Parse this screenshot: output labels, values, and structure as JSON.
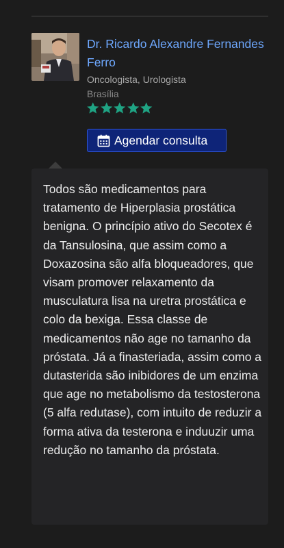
{
  "doctor": {
    "name": "Dr. Ricardo Alexandre Fernandes Ferro",
    "specialty": "Oncologista, Urologista",
    "city": "Brasília",
    "rating_stars": 5,
    "rating_max": 5
  },
  "actions": {
    "book_label": "Agendar consulta"
  },
  "answer": {
    "text": "Todos são medicamentos para tratamento de Hiperplasia prostática benigna. O princípio ativo do Secotex é da Tansulosina, que assim como a Doxazosina são alfa bloqueadores, que visam promover relaxamento da musculatura lisa na uretra prostática e colo da bexiga. Essa classe de medicamentos não age no tamanho da próstata. Já a finasteriada, assim como a dutasterida são inibidores de um enzima que age no metabolismo da testosterona (5 alfa redutase), com intuito de reduzir a forma ativa da testerona e induuzir uma redução no tamanho da próstata."
  },
  "colors": {
    "background": "#1c1c1c",
    "name_link": "#6ea8fe",
    "star": "#1fa383",
    "button_bg": "#0e2478",
    "answer_bg": "#242426"
  },
  "icons": {
    "avatar": "doctor-photo",
    "star": "star-icon",
    "calendar": "calendar-icon"
  }
}
